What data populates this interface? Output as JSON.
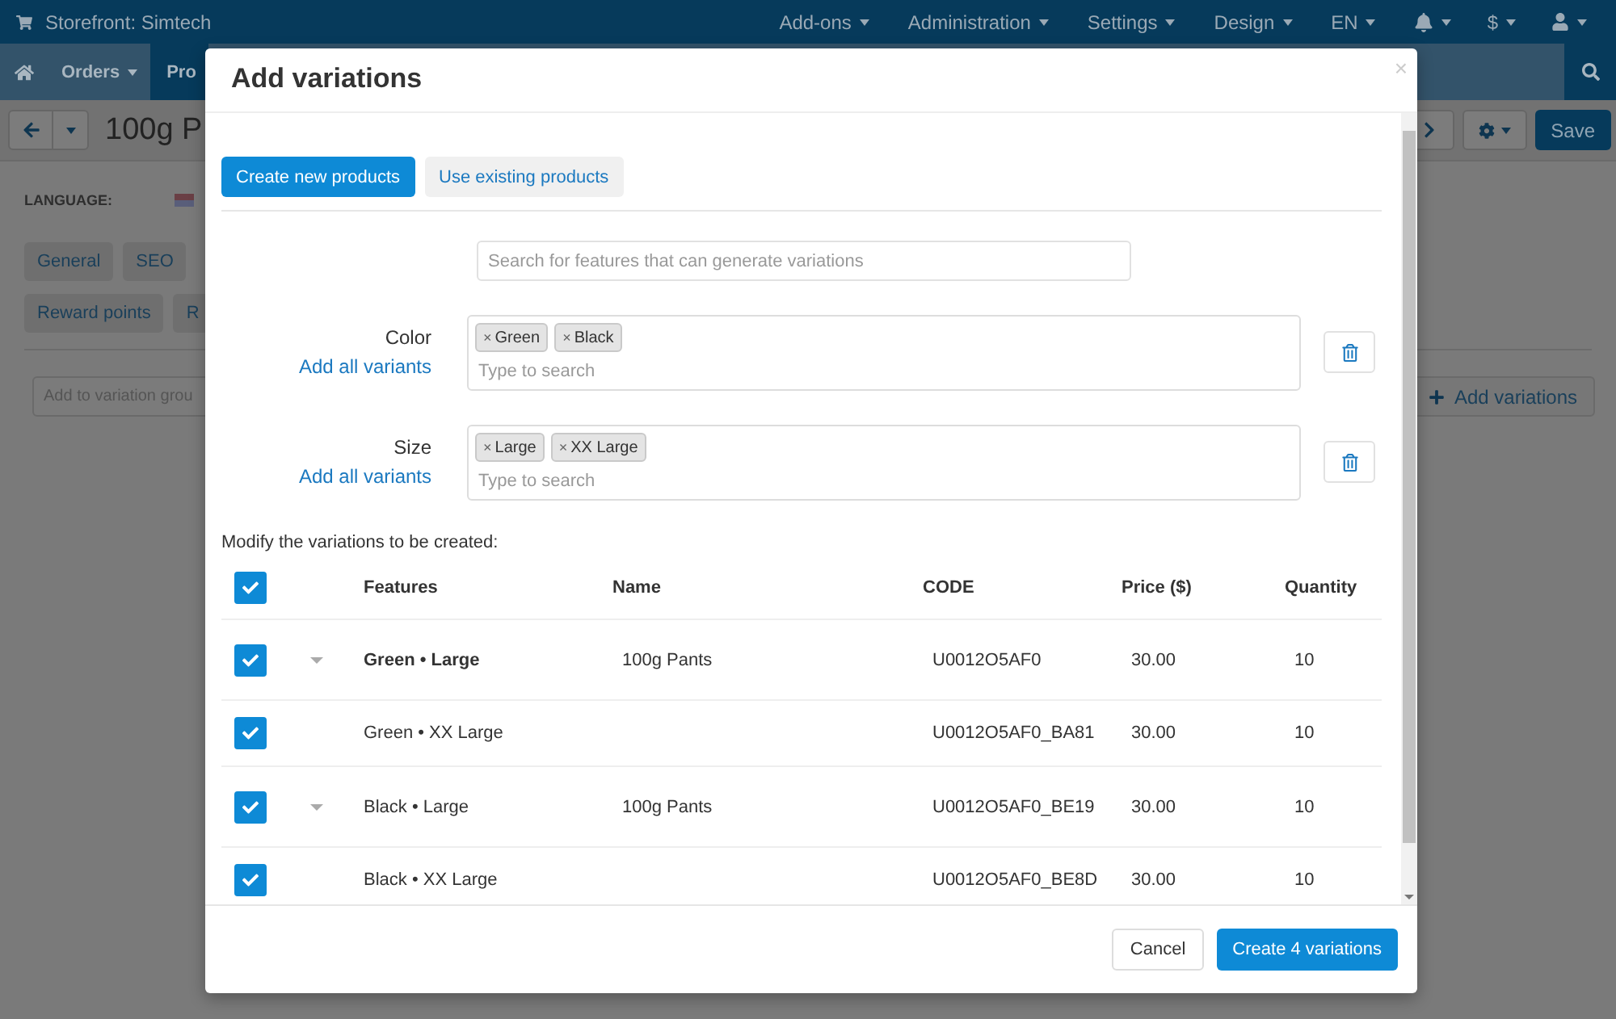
{
  "topbar": {
    "store": "Storefront: Simtech",
    "menus": [
      {
        "label": "Add-ons"
      },
      {
        "label": "Administration"
      },
      {
        "label": "Settings"
      },
      {
        "label": "Design"
      },
      {
        "label": "EN"
      }
    ],
    "currency": "$"
  },
  "navbar": {
    "tabs": [
      {
        "label": "Orders",
        "selected": false
      },
      {
        "label": "Pro",
        "selected": true
      }
    ]
  },
  "toolbar": {
    "title": "100g P",
    "save": "Save"
  },
  "page": {
    "language_label": "LANGUAGE:",
    "tab_rows": [
      [
        {
          "label": "General"
        },
        {
          "label": "SEO"
        }
      ],
      [
        {
          "label": "Reward points"
        },
        {
          "label": "R"
        }
      ]
    ],
    "variation_group_placeholder": "Add to variation grou",
    "add_variations": "Add variations"
  },
  "modal": {
    "title": "Add variations",
    "close": "×",
    "modes": [
      {
        "label": "Create new products",
        "selected": true
      },
      {
        "label": "Use existing products",
        "selected": false
      }
    ],
    "search_placeholder": "Search for features that can generate variations",
    "features": [
      {
        "name": "Color",
        "add_all": "Add all variants",
        "placeholder": "Type to search",
        "variants": [
          {
            "remove": "×",
            "label": "Green"
          },
          {
            "remove": "×",
            "label": "Black"
          }
        ]
      },
      {
        "name": "Size",
        "add_all": "Add all variants",
        "placeholder": "Type to search",
        "variants": [
          {
            "remove": "×",
            "label": "Large"
          },
          {
            "remove": "×",
            "label": "XX Large"
          }
        ]
      }
    ],
    "table_caption": "Modify the variations to be created:",
    "table": {
      "all_checked": true,
      "columns": [
        "Features",
        "Name",
        "CODE",
        "Price ($)",
        "Quantity"
      ],
      "rows": [
        {
          "checked": true,
          "expandable": true,
          "current": true,
          "features": "Green • Large",
          "name": "100g Pants",
          "code": "U0012O5AF0",
          "price": "30.00",
          "quantity": "10"
        },
        {
          "checked": true,
          "expandable": false,
          "current": false,
          "features": "Green • XX Large",
          "code": "U0012O5AF0_BA81",
          "price": "30.00",
          "quantity": "10"
        },
        {
          "checked": true,
          "expandable": true,
          "current": false,
          "features": "Black • Large",
          "name": "100g Pants",
          "code": "U0012O5AF0_BE19",
          "price": "30.00",
          "quantity": "10"
        },
        {
          "checked": true,
          "expandable": false,
          "current": false,
          "features": "Black • XX Large",
          "code": "U0012O5AF0_BE8D",
          "price": "30.00",
          "quantity": "10"
        }
      ]
    },
    "cancel": "Cancel",
    "submit": "Create 4 variations"
  }
}
